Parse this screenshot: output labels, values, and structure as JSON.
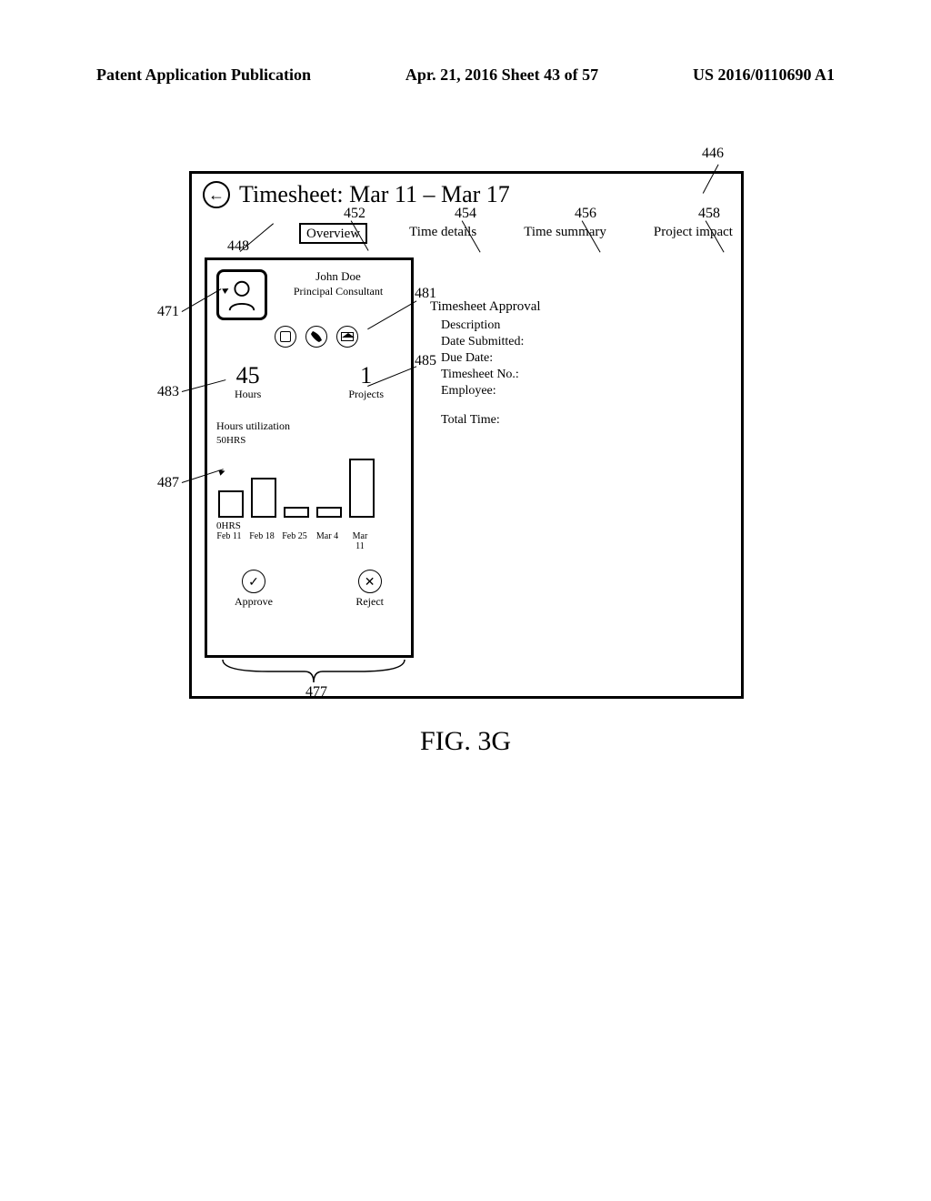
{
  "header": {
    "left": "Patent Application Publication",
    "mid": "Apr. 21, 2016  Sheet 43 of 57",
    "right": "US 2016/0110690 A1"
  },
  "title": "Timesheet:  Mar 11 – Mar 17",
  "tabs": {
    "overview": "Overview",
    "time_details": "Time details",
    "time_summary": "Time summary",
    "project_impact": "Project impact"
  },
  "card": {
    "name": "John Doe",
    "role": "Principal Consultant",
    "hours_val": "45",
    "hours_lbl": "Hours",
    "projects_val": "1",
    "projects_lbl": "Projects",
    "util_title": "Hours utilization",
    "axis_top": "50HRS",
    "axis_bot": "0HRS",
    "x_labels": [
      "Feb 11",
      "Feb 18",
      "Feb 25",
      "Mar 4",
      "Mar 11"
    ],
    "approve": "Approve",
    "reject": "Reject"
  },
  "overview": {
    "heading": "Timesheet Approval",
    "description": "Description",
    "date_submitted": "Date Submitted:",
    "due_date": "Due Date:",
    "timesheet_no": "Timesheet No.:",
    "employee": "Employee:",
    "total_time": "Total Time:"
  },
  "callouts": {
    "c446": "446",
    "c448": "448",
    "c452": "452",
    "c454": "454",
    "c456": "456",
    "c458": "458",
    "c471": "471",
    "c481": "481",
    "c483": "483",
    "c485": "485",
    "c487": "487",
    "c477": "477"
  },
  "figcap": "FIG. 3G",
  "chart_data": {
    "type": "bar",
    "title": "Hours utilization",
    "xlabel": "",
    "ylabel": "Hours",
    "ylim": [
      0,
      50
    ],
    "categories": [
      "Feb 11",
      "Feb 18",
      "Feb 25",
      "Mar 4",
      "Mar 11"
    ],
    "values": [
      20,
      30,
      8,
      8,
      44
    ]
  }
}
